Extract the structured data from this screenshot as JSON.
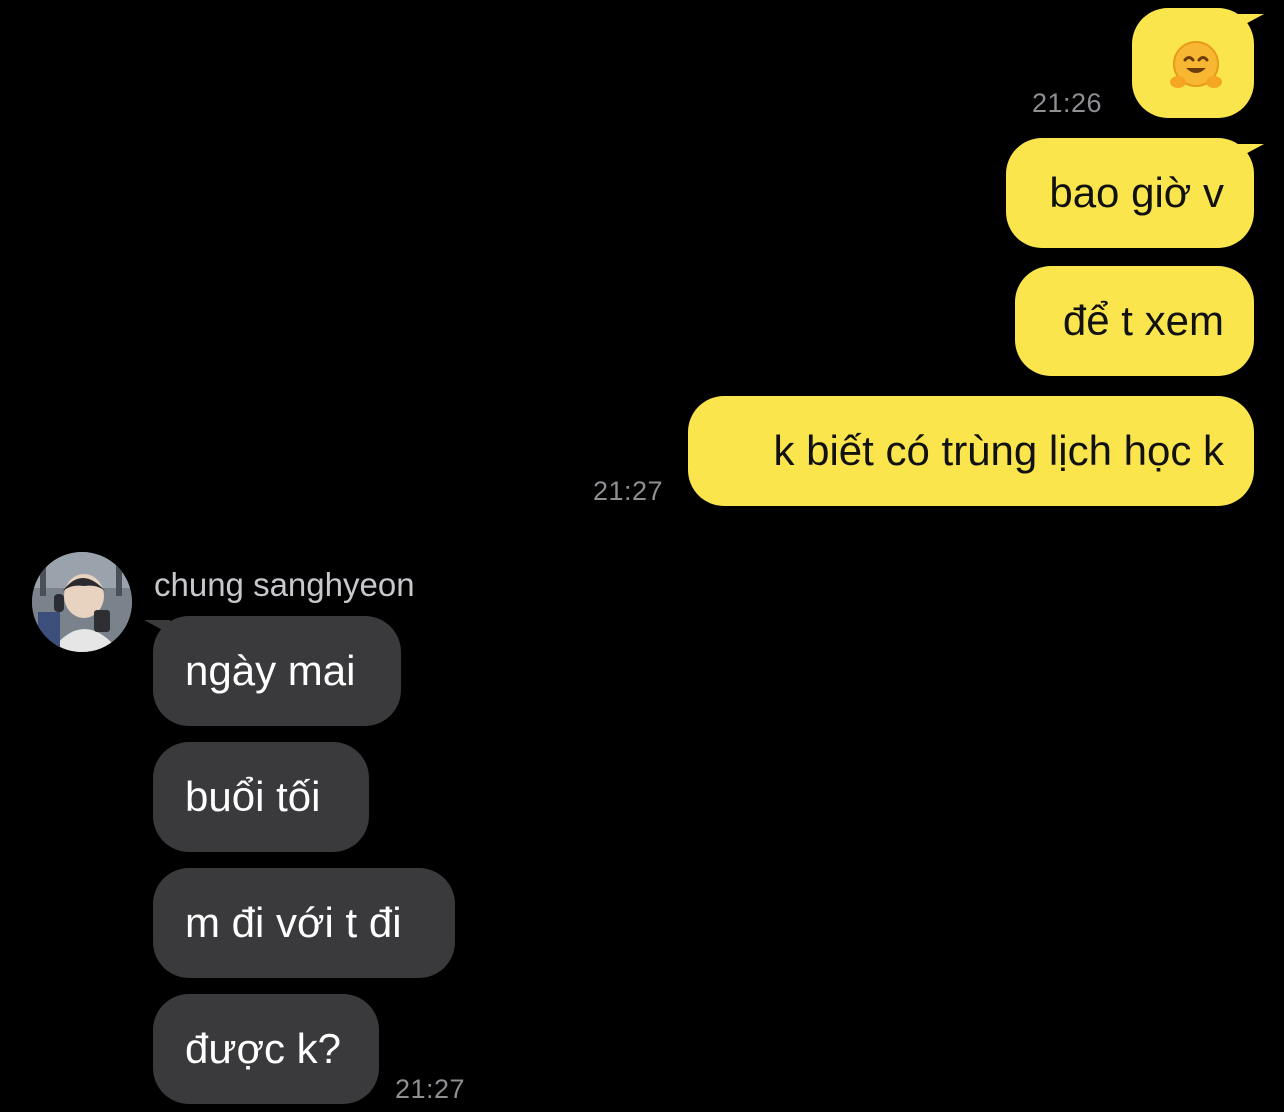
{
  "colors": {
    "background": "#000000",
    "outgoing_bubble": "#fbe54d",
    "incoming_bubble": "#3a3a3c",
    "timestamp": "#8e8e93"
  },
  "outgoing": {
    "emoji_message": {
      "icon": "hugging-face-emoji",
      "time": "21:26"
    },
    "messages": [
      {
        "text": "bao giờ v"
      },
      {
        "text": "để t xem"
      },
      {
        "text": "k biết có trùng lịch học k",
        "time": "21:27"
      }
    ]
  },
  "incoming": {
    "sender": "chung sanghyeon",
    "avatar": "profile-photo",
    "messages": [
      {
        "text": "ngày mai"
      },
      {
        "text": "buổi tối"
      },
      {
        "text": "m đi với t đi"
      },
      {
        "text": "được k?",
        "time": "21:27"
      }
    ]
  }
}
